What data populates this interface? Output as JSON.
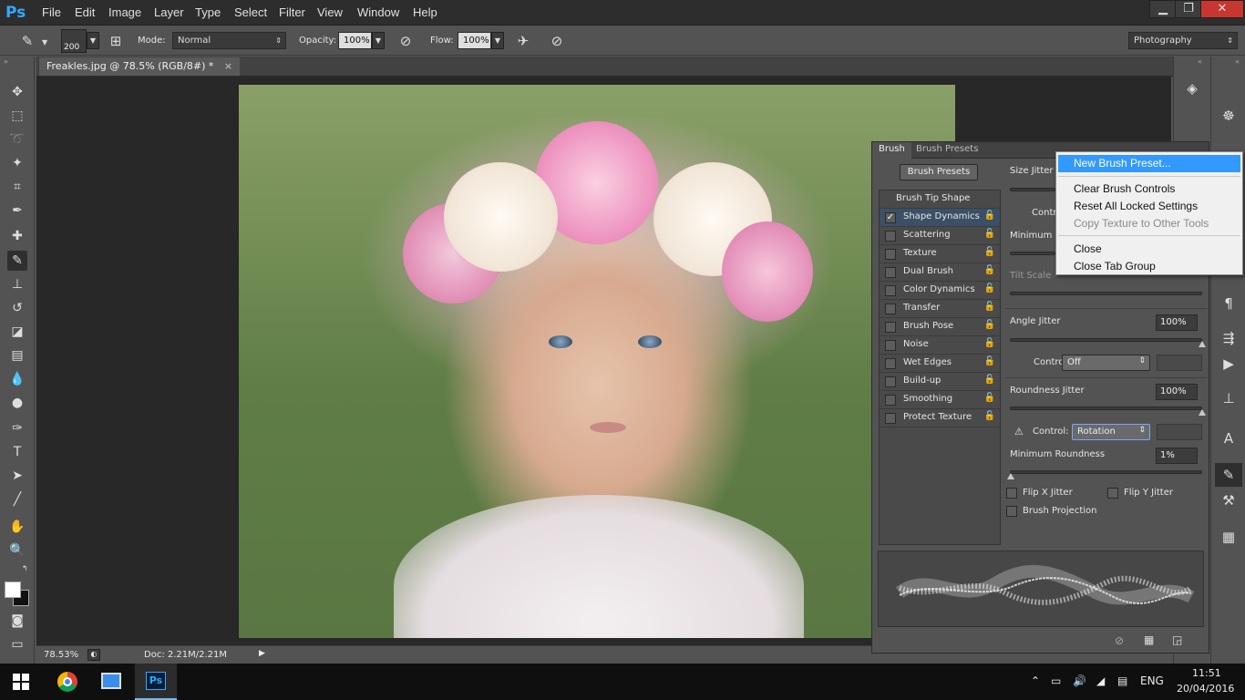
{
  "app": {
    "logo": "Ps"
  },
  "menu": [
    "File",
    "Edit",
    "Image",
    "Layer",
    "Type",
    "Select",
    "Filter",
    "View",
    "Window",
    "Help"
  ],
  "window_controls": {
    "minimize": "▁",
    "restore": "❐",
    "close": "✕"
  },
  "options": {
    "brush_size": "200",
    "mode_label": "Mode:",
    "mode_value": "Normal",
    "opacity_label": "Opacity:",
    "opacity_value": "100%",
    "flow_label": "Flow:",
    "flow_value": "100%",
    "workspace": "Photography"
  },
  "document": {
    "tab_title": "Freakles.jpg @ 78.5% (RGB/8#) *",
    "tab_close": "×"
  },
  "status": {
    "zoom": "78.53%",
    "doc": "Doc: 2.21M/2.21M"
  },
  "brush_panel": {
    "tabs": [
      "Brush",
      "Brush Presets"
    ],
    "presets_button": "Brush Presets",
    "list_header": "Brush Tip Shape",
    "items": [
      {
        "label": "Shape Dynamics",
        "checked": true,
        "selected": true
      },
      {
        "label": "Scattering",
        "checked": false
      },
      {
        "label": "Texture",
        "checked": false
      },
      {
        "label": "Dual Brush",
        "checked": false
      },
      {
        "label": "Color Dynamics",
        "checked": false
      },
      {
        "label": "Transfer",
        "checked": false
      },
      {
        "label": "Brush Pose",
        "checked": false
      },
      {
        "label": "Noise",
        "checked": false
      },
      {
        "label": "Wet Edges",
        "checked": false
      },
      {
        "label": "Build-up",
        "checked": false
      },
      {
        "label": "Smoothing",
        "checked": false
      },
      {
        "label": "Protect Texture",
        "checked": false
      }
    ],
    "size_jitter": "Size Jitter",
    "control_partial": "Contro",
    "min_diameter_partial": "Minimum D",
    "tilt_scale": "Tilt Scale",
    "angle_jitter": {
      "label": "Angle Jitter",
      "value": "100%"
    },
    "angle_control": {
      "label": "Control:",
      "value": "Off"
    },
    "roundness_jitter": {
      "label": "Roundness Jitter",
      "value": "100%"
    },
    "roundness_control": {
      "label": "Control:",
      "value": "Rotation",
      "warning": "⚠"
    },
    "min_roundness": {
      "label": "Minimum Roundness",
      "value": "1%"
    },
    "flip_x": "Flip X Jitter",
    "flip_y": "Flip Y Jitter",
    "brush_projection": "Brush Projection"
  },
  "flyout_menu": {
    "new_preset": "New Brush Preset...",
    "clear_controls": "Clear Brush Controls",
    "reset_locked": "Reset All Locked Settings",
    "copy_texture": "Copy Texture to Other Tools",
    "close": "Close",
    "close_group": "Close Tab Group"
  },
  "taskbar": {
    "language": "ENG",
    "time": "11:51",
    "date": "20/04/2016",
    "ps_label": "Ps"
  },
  "colors": {
    "accent": "#31a8ff",
    "highlight": "#3399ff",
    "selected_row": "#3b4f66"
  }
}
